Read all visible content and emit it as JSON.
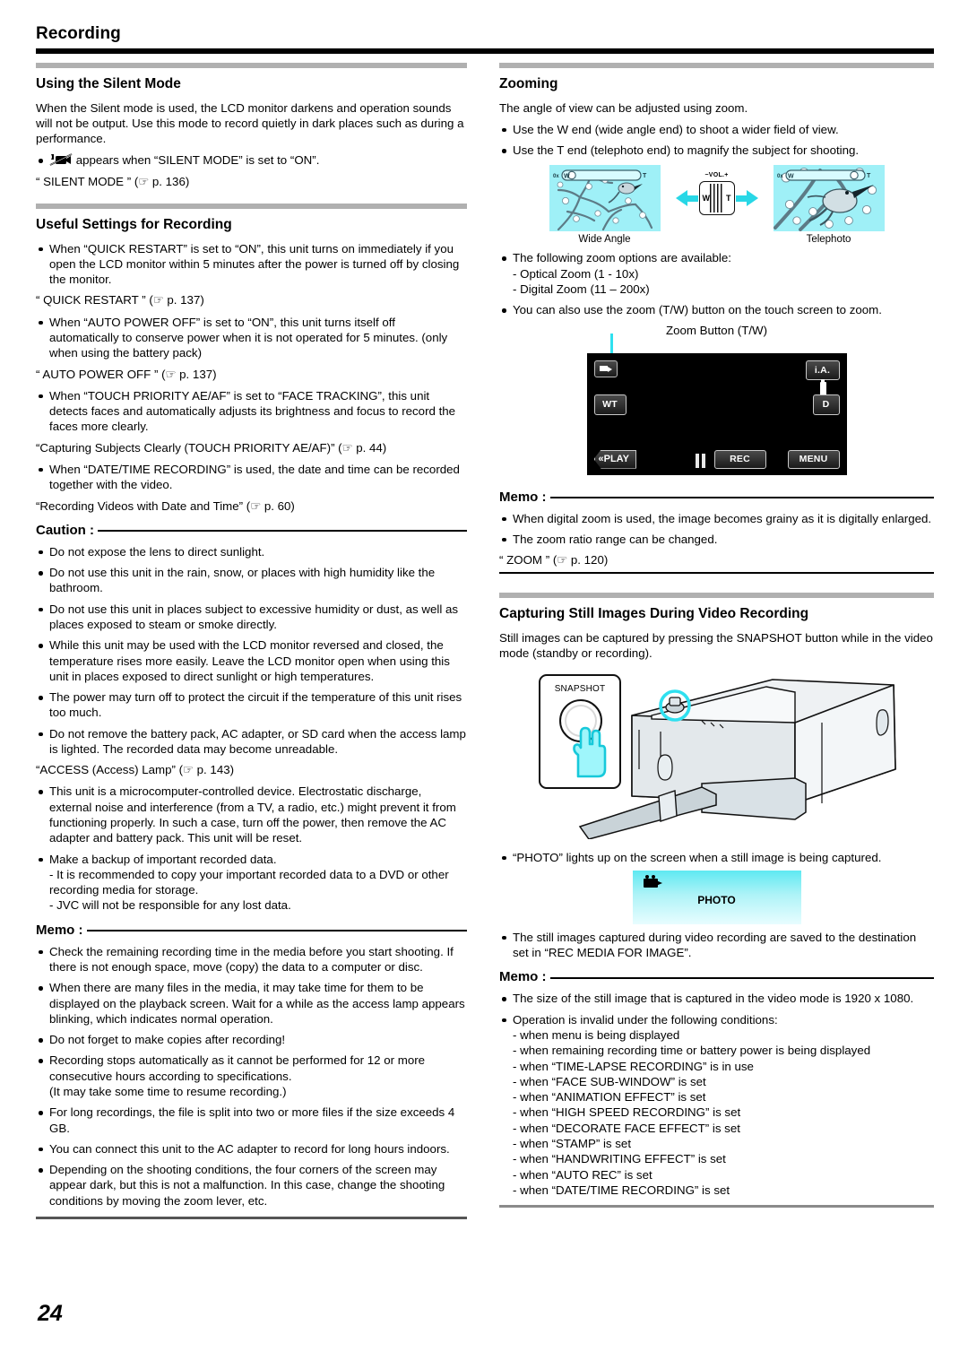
{
  "header": {
    "title": "Recording"
  },
  "page_number": "24",
  "left_column": {
    "section1": {
      "heading": "Using the Silent Mode",
      "paragraph": "When the Silent mode is used, the LCD monitor darkens and operation sounds will not be output. Use this mode to record quietly in dark places such as during a performance.",
      "bullet_icon_text": "appears when “SILENT MODE” is set to “ON”.",
      "reference": "“ SILENT MODE ” (☞ p. 136)"
    },
    "section2": {
      "heading": "Useful Settings for Recording",
      "items": [
        {
          "bullet": "When “QUICK RESTART” is set to “ON”, this unit turns on immediately if you open the LCD monitor within 5 minutes after the power is turned off by closing the monitor.",
          "ref": "“ QUICK RESTART ” (☞ p. 137)"
        },
        {
          "bullet": "When “AUTO POWER OFF” is set to “ON”, this unit turns itself off automatically to conserve power when it is not operated for 5 minutes. (only when using the battery pack)",
          "ref": "“ AUTO POWER OFF ” (☞ p. 137)"
        },
        {
          "bullet": "When “TOUCH PRIORITY AE/AF” is set to “FACE TRACKING”, this unit detects faces and automatically adjusts its brightness and focus to record the faces more clearly.",
          "ref": "“Capturing Subjects Clearly (TOUCH PRIORITY AE/AF)” (☞ p. 44)"
        },
        {
          "bullet": "When “DATE/TIME RECORDING” is used, the date and time can be recorded together with the video.",
          "ref": "“Recording Videos with Date and Time” (☞ p. 60)"
        }
      ]
    },
    "caution": {
      "label": "Caution :",
      "items": [
        "Do not expose the lens to direct sunlight.",
        "Do not use this unit in the rain, snow, or places with high humidity like the bathroom.",
        "Do not use this unit in places subject to excessive humidity or dust, as well as places exposed to steam or smoke directly.",
        "While this unit may be used with the LCD monitor reversed and closed, the temperature rises more easily. Leave the LCD monitor open when using this unit in places exposed to direct sunlight or high temperatures.",
        "The power may turn off to protect the circuit if the temperature of this unit rises too much.",
        "Do not remove the battery pack, AC adapter, or SD card when the access lamp is lighted. The recorded data may become unreadable."
      ],
      "reference": "“ACCESS (Access) Lamp” (☞ p. 143)",
      "items_after": [
        "This unit is a microcomputer-controlled device. Electrostatic discharge, external noise and interference (from a TV, a radio, etc.) might prevent it from functioning properly. In such a case, turn off the power, then remove the AC adapter and battery pack. This unit will be reset.",
        "Make a backup of important recorded data.\n- It is recommended to copy your important recorded data to a DVD or other recording media for storage.\n- JVC will not be responsible for any lost data."
      ]
    },
    "memo": {
      "label": "Memo :",
      "items": [
        "Check the remaining recording time in the media before you start shooting. If there is not enough space, move (copy) the data to a computer or disc.",
        "When there are many files in the media, it may take time for them to be displayed on the playback screen. Wait for a while as the access lamp appears blinking, which indicates normal operation.",
        "Do not forget to make copies after recording!",
        "Recording stops automatically as it cannot be performed for 12 or more consecutive hours according to specifications.\n(It may take some time to resume recording.)",
        "For long recordings, the file is split into two or more files if the size exceeds 4 GB.",
        "You can connect this unit to the AC adapter to record for long hours indoors.",
        "Depending on the shooting conditions, the four corners of the screen may appear dark, but this is not a malfunction. In this case, change the shooting conditions by moving the zoom lever, etc."
      ]
    }
  },
  "right_column": {
    "zooming": {
      "heading": "Zooming",
      "paragraph": "The angle of view can be adjusted using zoom.",
      "items": [
        "Use the W end (wide angle end) to shoot a wider field of view.",
        "Use the T end (telephoto end) to magnify the subject for shooting."
      ],
      "figure": {
        "left_caption": "Wide Angle",
        "right_caption": "Telephoto",
        "lever_label": "−VOL.+",
        "lever_w": "W",
        "lever_t": "T",
        "zoom_ratio_left": "0x",
        "zoom_bar_w": "W",
        "zoom_bar_t": "T"
      },
      "options_intro": "The following zoom options are available:",
      "options": [
        "- Optical Zoom (1 - 10x)",
        "- Digital Zoom (11 – 200x)"
      ],
      "touch_bullet": "You can also use the zoom (T/W) button on the touch screen to zoom.",
      "screen_caption": "Zoom Button (T/W)",
      "lcd": {
        "zoom_button": "WT",
        "ia_button": "i.A.",
        "d_button": "D",
        "play_button": "PLAY",
        "rec_button": "REC",
        "menu_button": "MENU"
      },
      "memo": {
        "label": "Memo :",
        "items": [
          "When digital zoom is used, the image becomes grainy as it is digitally enlarged.",
          "The zoom ratio range can be changed."
        ],
        "reference": "“ ZOOM ” (☞ p. 120)"
      }
    },
    "capturing": {
      "heading": "Capturing Still Images During Video Recording",
      "paragraph": "Still images can be captured by pressing the SNAPSHOT button while in the video mode (standby or recording).",
      "figure": {
        "snapshot_label": "SNAPSHOT"
      },
      "bullet_photo": "“PHOTO” lights up on the screen when a still image is being captured.",
      "photo_indicator": "PHOTO",
      "bullet_dest": "The still images captured during video recording are saved to the destination set in “REC MEDIA FOR IMAGE”.",
      "memo": {
        "label": "Memo :",
        "item1": "The size of the still image that is captured in the video mode is 1920 x 1080.",
        "item2": "Operation is invalid under the following conditions:",
        "conditions": [
          "- when menu is being displayed",
          "- when remaining recording time or battery power is being displayed",
          "- when “TIME-LAPSE RECORDING” is in use",
          "- when “FACE SUB-WINDOW” is set",
          "- when “ANIMATION EFFECT” is set",
          "- when “HIGH SPEED RECORDING” is set",
          "- when “DECORATE FACE EFFECT” is set",
          "- when “STAMP” is set",
          "- when “HANDWRITING EFFECT” is set",
          "- when “AUTO REC” is set",
          "- when “DATE/TIME RECORDING” is set"
        ]
      }
    }
  },
  "colors": {
    "accent_cyan": "#2fe0ef",
    "rule_black": "#000000",
    "section_bar_gray": "#b0b0b0"
  }
}
